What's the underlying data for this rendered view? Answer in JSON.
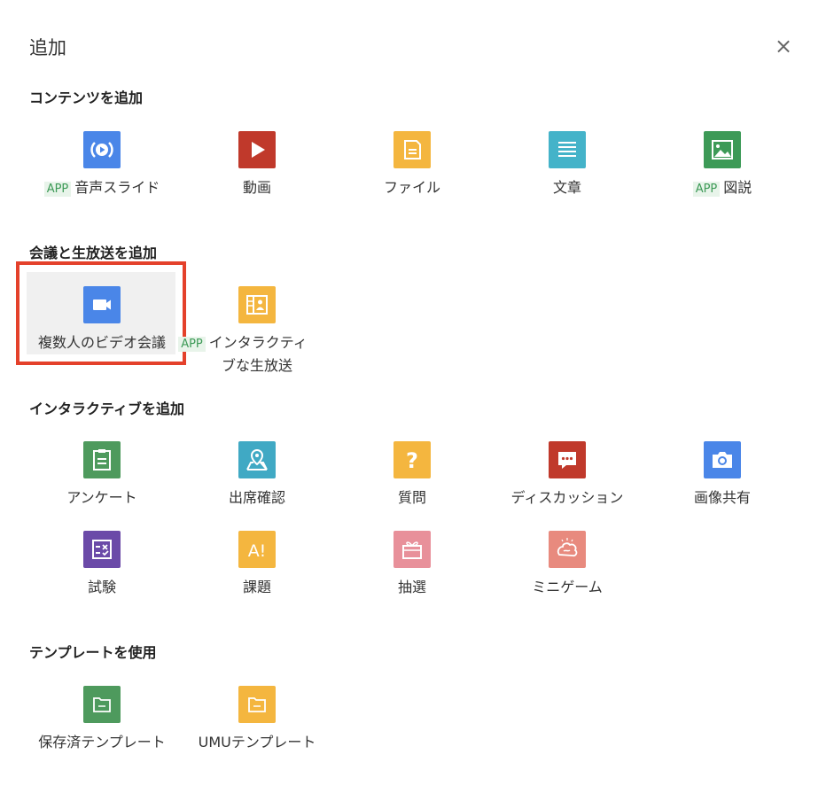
{
  "dialog": {
    "title": "追加",
    "close_symbol": "×"
  },
  "app_badge": "APP",
  "sections": {
    "content": {
      "title": "コンテンツを追加"
    },
    "meeting": {
      "title": "会議と生放送を追加"
    },
    "interactive": {
      "title": "インタラクティブを追加"
    },
    "template": {
      "title": "テンプレートを使用"
    }
  },
  "items": {
    "audio_slide": {
      "label": "音声スライド",
      "icon": "play-circle-icon",
      "color": "#4a86e8"
    },
    "video": {
      "label": "動画",
      "icon": "play-icon",
      "color": "#c0392b"
    },
    "file": {
      "label": "ファイル",
      "icon": "file-icon",
      "color": "#f4b63f"
    },
    "article": {
      "label": "文章",
      "icon": "lines-icon",
      "color": "#44b3c9"
    },
    "illustration": {
      "label": "図説",
      "icon": "image-icon",
      "color": "#3d9a57"
    },
    "video_meeting": {
      "label": "複数人のビデオ会議",
      "icon": "video-camera-icon",
      "color": "#4a86e8"
    },
    "live_broadcast": {
      "label_line1": "インタラクティ",
      "label_line2": "ブな生放送",
      "icon": "broadcast-icon",
      "color": "#f4b63f"
    },
    "survey": {
      "label": "アンケート",
      "icon": "clipboard-icon",
      "color": "#4e9a5d"
    },
    "attendance": {
      "label": "出席確認",
      "icon": "map-pin-icon",
      "color": "#40a9c4"
    },
    "question": {
      "label": "質問",
      "icon": "question-icon",
      "color": "#f4b63f"
    },
    "discussion": {
      "label": "ディスカッション",
      "icon": "chat-icon",
      "color": "#c0392b"
    },
    "image_share": {
      "label": "画像共有",
      "icon": "camera-icon",
      "color": "#4a86e8"
    },
    "exam": {
      "label": "試験",
      "icon": "exam-icon",
      "color": "#6b4aa8"
    },
    "assignment": {
      "label": "課題",
      "icon": "assignment-icon",
      "color": "#f4b63f"
    },
    "lottery": {
      "label": "抽選",
      "icon": "gift-icon",
      "color": "#e8909a"
    },
    "mini_game": {
      "label": "ミニゲーム",
      "icon": "brain-icon",
      "color": "#e88a7e"
    },
    "saved_template": {
      "label": "保存済テンプレート",
      "icon": "folder-icon",
      "color": "#4e9a5d"
    },
    "umu_template": {
      "label": "UMUテンプレート",
      "icon": "folder-icon",
      "color": "#f4b63f"
    }
  }
}
